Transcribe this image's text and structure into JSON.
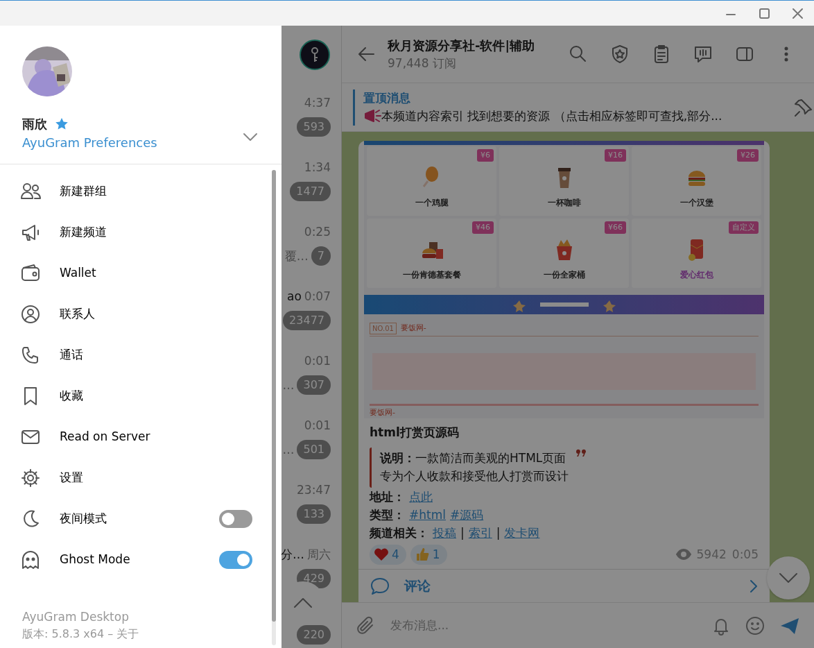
{
  "drawer": {
    "profile": {
      "name": "雨欣",
      "subtitle": "AyuGram Preferences"
    },
    "menu": [
      {
        "label": "新建群组",
        "kind": "action"
      },
      {
        "label": "新建频道",
        "kind": "action"
      },
      {
        "label": "Wallet",
        "kind": "action"
      },
      {
        "label": "联系人",
        "kind": "action"
      },
      {
        "label": "通话",
        "kind": "action"
      },
      {
        "label": "收藏",
        "kind": "action"
      },
      {
        "label": "Read on Server",
        "kind": "action"
      },
      {
        "label": "设置",
        "kind": "action"
      },
      {
        "label": "夜间模式",
        "kind": "toggle",
        "on": false
      },
      {
        "label": "Ghost Mode",
        "kind": "toggle",
        "on": true
      }
    ],
    "footer": {
      "app": "AyuGram Desktop",
      "version": "版本: 5.8.3 x64  – 关于"
    }
  },
  "chat_list": {
    "rows": [
      {
        "time": "4:37",
        "badge": "593"
      },
      {
        "time": "1:34",
        "badge": "1477"
      },
      {
        "time": "0:25",
        "preview": "覆…",
        "badge": "7"
      },
      {
        "title": "ao",
        "time": "0:07",
        "badge": "23477"
      },
      {
        "time": "0:01",
        "preview": "…",
        "badge": "307"
      },
      {
        "time": "0:01",
        "preview": "…",
        "badge": "501"
      },
      {
        "time": "23:47",
        "badge": "133"
      },
      {
        "title": "分…",
        "time": "周六",
        "badge": "429"
      },
      {
        "badge": "220"
      }
    ]
  },
  "chat": {
    "title": "秋月资源分享社-软件|辅助",
    "subscribers": "97,448 订阅",
    "pinned": {
      "label": "置顶消息",
      "text": "本频道内容索引 找到想要的资源 （点击相应标签即可查找,部分..."
    },
    "message": {
      "image": {
        "tiles": [
          {
            "price": "¥6",
            "label": "一个鸡腿",
            "kind": "fixed"
          },
          {
            "price": "¥16",
            "label": "一杯咖啡",
            "kind": "fixed"
          },
          {
            "price": "¥26",
            "label": "一个汉堡",
            "kind": "fixed"
          },
          {
            "price": "¥46",
            "label": "一份肯德基套餐",
            "kind": "fixed"
          },
          {
            "price": "¥66",
            "label": "一份全家桶",
            "kind": "fixed"
          },
          {
            "price": "自定义",
            "label": "爱心红包",
            "kind": "custom"
          }
        ],
        "section_no": "NO.01",
        "section_title": "要饭网-",
        "footer_title": "要饭网-"
      },
      "title": "html打赏页源码",
      "quote": [
        "**说明：**一款简洁而美观的HTML页面",
        "专为个人收款和接受他人打赏而设计"
      ],
      "fields": [
        {
          "label": "地址：",
          "parts": [
            {
              "text": "点此",
              "link": true
            }
          ]
        },
        {
          "label": "类型：",
          "parts": [
            {
              "text": "#html",
              "link": true
            },
            {
              "text": "#源码",
              "link": true
            }
          ]
        },
        {
          "label": "频道相关：",
          "parts": [
            {
              "text": "投稿",
              "link": true
            },
            {
              "text": "|",
              "link": false
            },
            {
              "text": "索引",
              "link": true
            },
            {
              "text": "|",
              "link": false
            },
            {
              "text": "发卡网",
              "link": true
            }
          ]
        }
      ],
      "reactions": [
        {
          "count": "4"
        },
        {
          "count": "1"
        }
      ],
      "views": "5942",
      "time": "0:05",
      "comments": "评论"
    },
    "composer": {
      "placeholder": "发布消息..."
    }
  }
}
